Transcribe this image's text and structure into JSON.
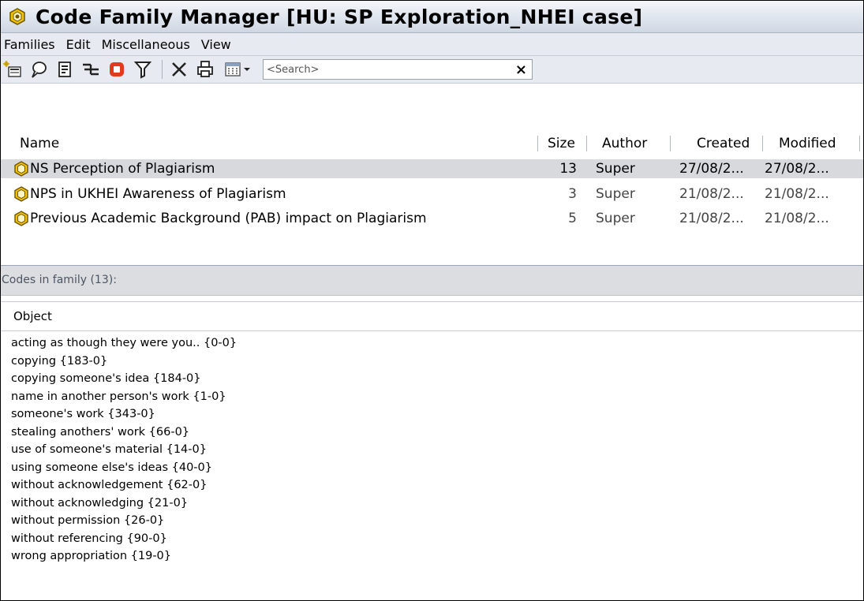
{
  "window": {
    "title": "Code Family Manager [HU: SP Exploration_NHEI case]"
  },
  "menu": {
    "items": [
      "Families",
      "Edit",
      "Miscellaneous",
      "View"
    ]
  },
  "toolbar": {
    "search_placeholder": "<Search>",
    "clear_label": "×",
    "buttons": [
      "new-family-icon",
      "comment-icon",
      "document-icon",
      "tree-icon",
      "stop-icon",
      "filter-icon",
      "delete-icon",
      "print-icon",
      "grid-view-icon"
    ]
  },
  "families_table": {
    "columns": [
      "Name",
      "Size",
      "Author",
      "Created",
      "Modified"
    ],
    "rows": [
      {
        "name": "NS Perception of Plagiarism",
        "size": "13",
        "author": "Super",
        "created": "27/08/2...",
        "modified": "27/08/2...",
        "selected": true
      },
      {
        "name": "NPS in UKHEI Awareness of Plagiarism",
        "size": "3",
        "author": "Super",
        "created": "21/08/2...",
        "modified": "21/08/2...",
        "selected": false
      },
      {
        "name": "Previous Academic Background (PAB) impact on Plagiarism",
        "size": "5",
        "author": "Super",
        "created": "21/08/2...",
        "modified": "21/08/2...",
        "selected": false
      }
    ]
  },
  "codes_pane": {
    "label": "Codes in family (13):",
    "column": "Object",
    "items": [
      "acting as though they were you.. {0-0}",
      "copying {183-0}",
      "copying someone's idea {184-0}",
      "name in another person's work {1-0}",
      "someone's work {343-0}",
      "stealing anothers' work {66-0}",
      "use of someone's material {14-0}",
      "using someone else's ideas {40-0}",
      "without acknowledgement {62-0}",
      "without acknowledging {21-0}",
      "without permission {26-0}",
      "without referencing {90-0}",
      "wrong appropriation {19-0}"
    ]
  },
  "colors": {
    "title_gradient_top": "#f4f6f9",
    "title_gradient_bottom": "#cfd7e2",
    "toolbar_bg": "#e7ebf1",
    "selected_row": "#d8d9dd",
    "family_icon_yellow": "#f2c200",
    "stop_icon_red": "#e23a1c"
  }
}
